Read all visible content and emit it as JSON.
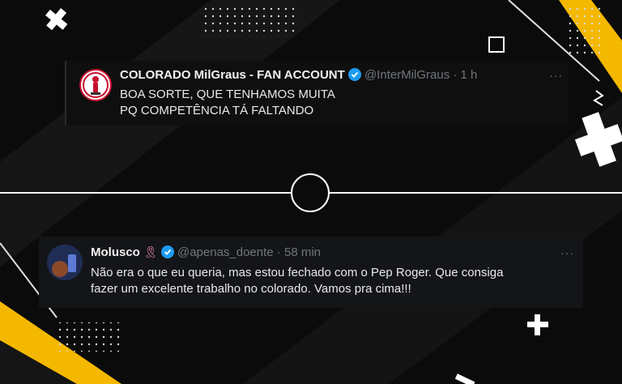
{
  "tweets": [
    {
      "display_name": "COLORADO MilGraus - FAN ACCOUNT",
      "handle": "@InterMilGraus",
      "separator": "·",
      "time": "1 h",
      "text_line1": "BOA SORTE, QUE TENHAMOS MUITA",
      "text_line2": "PQ COMPETÊNCIA TÁ FALTANDO",
      "more": "···"
    },
    {
      "display_name": "Molusco",
      "handle": "@apenas_doente",
      "separator": "·",
      "time": "58 min",
      "text_line1": "Não era o que eu queria, mas estou fechado com o Pep Roger. Que consiga",
      "text_line2": "fazer um excelente trabalho no colorado. Vamos pra cima!!!",
      "more": "···"
    }
  ],
  "colors": {
    "background": "#0b0b0b",
    "accent_yellow": "#f5b800",
    "verified_blue": "#1d9bf0",
    "text": "#e7e9ea",
    "muted": "#71767b"
  }
}
